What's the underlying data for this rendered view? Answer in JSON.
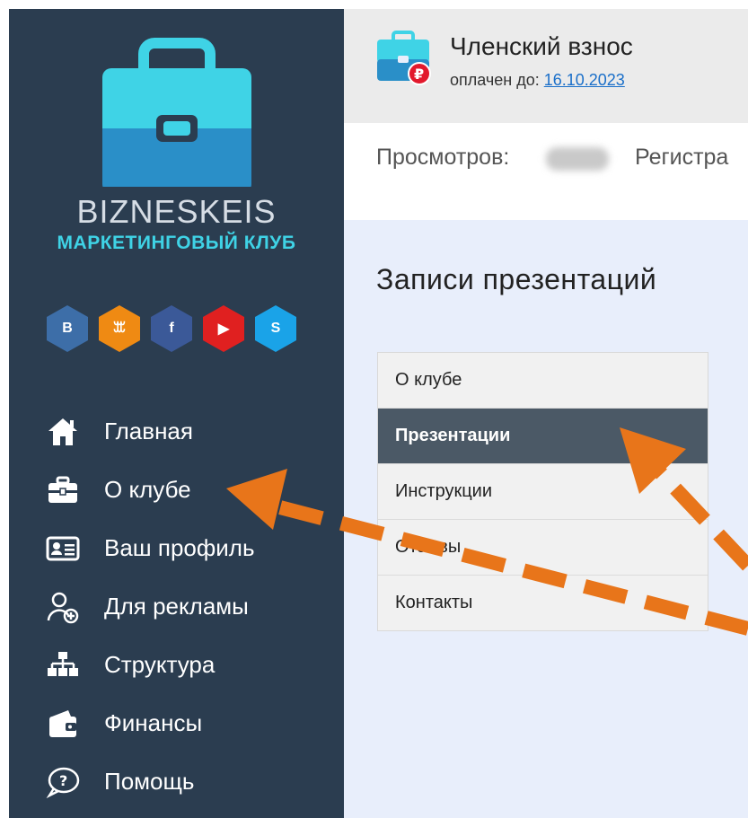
{
  "brand": {
    "name": "BIZNESKEIS",
    "tagline": "МАРКЕТИНГОВЫЙ КЛУБ"
  },
  "socials": [
    {
      "icon": "vk-icon",
      "glyph": "B",
      "color": "#3d6ea8"
    },
    {
      "icon": "odnoklassniki-icon",
      "glyph": "ꕭ",
      "color": "#ef8a13"
    },
    {
      "icon": "facebook-icon",
      "glyph": "f",
      "color": "#3b5998"
    },
    {
      "icon": "youtube-icon",
      "glyph": "▶",
      "color": "#e02020"
    },
    {
      "icon": "skype-icon",
      "glyph": "S",
      "color": "#1aa3e8"
    }
  ],
  "sidebar": {
    "items": [
      {
        "label": "Главная",
        "icon": "home-icon"
      },
      {
        "label": "О клубе",
        "icon": "briefcase-icon"
      },
      {
        "label": "Ваш профиль",
        "icon": "id-card-icon"
      },
      {
        "label": "Для рекламы",
        "icon": "user-plus-icon"
      },
      {
        "label": "Структура",
        "icon": "sitemap-icon"
      },
      {
        "label": "Финансы",
        "icon": "wallet-icon"
      },
      {
        "label": "Помощь",
        "icon": "help-bubble-icon"
      }
    ]
  },
  "membership": {
    "title": "Членский взнос",
    "paid_until_label": "оплачен до: ",
    "paid_until_date": "16.10.2023"
  },
  "stats": {
    "views_label": "Просмотров:",
    "registrations_label": "Регистра"
  },
  "main": {
    "title": "Записи презентаций",
    "menu": [
      {
        "label": "О клубе",
        "active": false
      },
      {
        "label": "Презентации",
        "active": true
      },
      {
        "label": "Инструкции",
        "active": false
      },
      {
        "label": "Отзывы",
        "active": false
      },
      {
        "label": "Контакты",
        "active": false
      }
    ]
  },
  "colors": {
    "sidebar_bg": "#2b3d50",
    "accent_cyan": "#3fd3e6",
    "arrow_orange": "#e8751a",
    "active_menu_bg": "#4b5966",
    "content_bg": "#e8eefb"
  }
}
